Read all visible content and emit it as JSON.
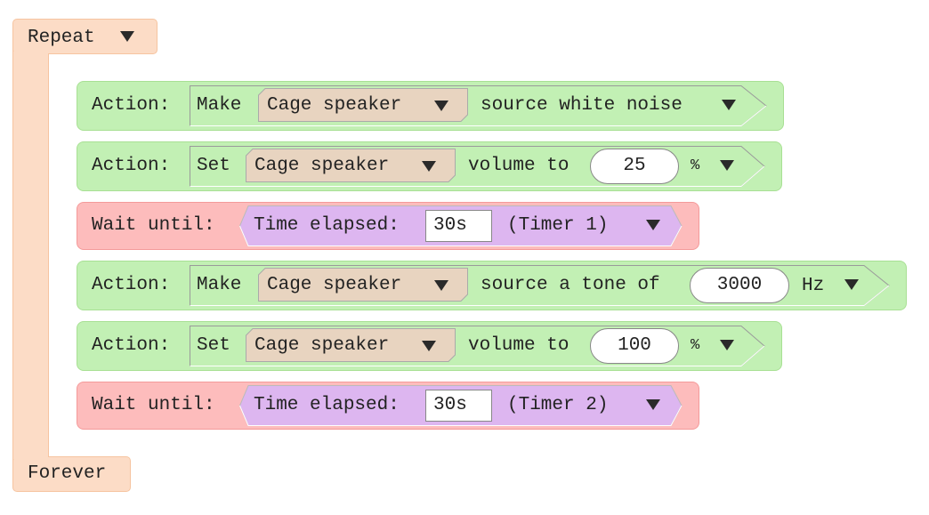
{
  "loop": {
    "start_label": "Repeat",
    "end_label": "Forever",
    "colors": {
      "loop": "#fcdcc6",
      "action": "#c2f0b4",
      "wait": "#fdbcbc",
      "condition": "#ddb6f0",
      "device": "#e8d4c0"
    }
  },
  "blocks": [
    {
      "type": "action",
      "prefix": "Action:",
      "verb": "Make",
      "device": "Cage speaker",
      "text": "source white noise"
    },
    {
      "type": "action",
      "prefix": "Action:",
      "verb": "Set",
      "device": "Cage speaker",
      "text": "volume to",
      "value": "25",
      "unit": "%"
    },
    {
      "type": "wait",
      "prefix": "Wait until:",
      "condition": "Time elapsed:",
      "value": "30s",
      "timer": "(Timer 1)"
    },
    {
      "type": "action",
      "prefix": "Action:",
      "verb": "Make",
      "device": "Cage speaker",
      "text": "source a tone of",
      "value": "3000",
      "unit": "Hz"
    },
    {
      "type": "action",
      "prefix": "Action:",
      "verb": "Set",
      "device": "Cage speaker",
      "text": "volume to",
      "value": "100",
      "unit": "%"
    },
    {
      "type": "wait",
      "prefix": "Wait until:",
      "condition": "Time elapsed:",
      "value": "30s",
      "timer": "(Timer 2)"
    }
  ],
  "icons": {
    "dropdown": "triangle-down-icon"
  }
}
